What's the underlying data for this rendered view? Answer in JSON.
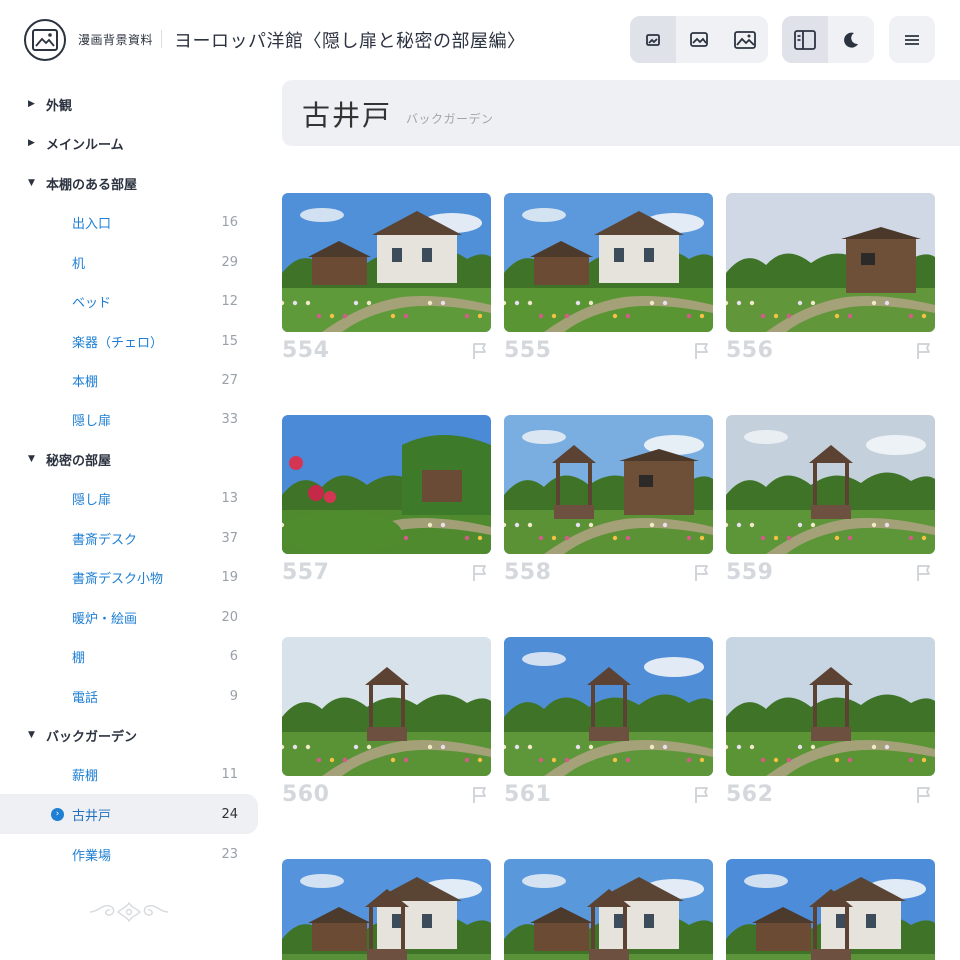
{
  "header": {
    "site_name": "漫画背景資料",
    "page_heading": "ヨーロッパ洋館〈隠し扉と秘密の部屋編〉",
    "size_buttons": [
      "image-small-icon",
      "image-medium-icon",
      "image-large-icon"
    ],
    "view_buttons": [
      "sidebar-toggle-icon",
      "moon-icon"
    ],
    "menu_button": "menu-icon"
  },
  "sidebar": {
    "sections": [
      {
        "label": "外観",
        "expanded": false
      },
      {
        "label": "メインルーム",
        "expanded": false
      },
      {
        "label": "本棚のある部屋",
        "expanded": true,
        "items": [
          {
            "label": "出入口",
            "count": "16"
          },
          {
            "label": "机",
            "count": "29"
          },
          {
            "label": "ベッド",
            "count": "12"
          },
          {
            "label": "楽器（チェロ）",
            "count": "15"
          },
          {
            "label": "本棚",
            "count": "27"
          },
          {
            "label": "隠し扉",
            "count": "33"
          }
        ]
      },
      {
        "label": "秘密の部屋",
        "expanded": true,
        "items": [
          {
            "label": "隠し扉",
            "count": "13"
          },
          {
            "label": "書斎デスク",
            "count": "37"
          },
          {
            "label": "書斎デスク小物",
            "count": "19"
          },
          {
            "label": "暖炉・絵画",
            "count": "20"
          },
          {
            "label": "棚",
            "count": "6"
          },
          {
            "label": "電話",
            "count": "9"
          }
        ]
      },
      {
        "label": "バックガーデン",
        "expanded": true,
        "items": [
          {
            "label": "薪棚",
            "count": "11"
          },
          {
            "label": "古井戸",
            "count": "24",
            "current": true
          },
          {
            "label": "作業場",
            "count": "23"
          }
        ]
      }
    ]
  },
  "main": {
    "title": "古井戸",
    "subtitle": "バックガーデン",
    "photos": [
      {
        "number": "554",
        "scene": "house"
      },
      {
        "number": "555",
        "scene": "house2"
      },
      {
        "number": "556",
        "scene": "shed"
      },
      {
        "number": "557",
        "scene": "roses"
      },
      {
        "number": "558",
        "scene": "shedwell"
      },
      {
        "number": "559",
        "scene": "wellfar"
      },
      {
        "number": "560",
        "scene": "wellside"
      },
      {
        "number": "561",
        "scene": "well"
      },
      {
        "number": "562",
        "scene": "wellclose"
      },
      {
        "number": "",
        "scene": "wellhouse"
      },
      {
        "number": "",
        "scene": "wellhouse2"
      },
      {
        "number": "",
        "scene": "wellhouse3"
      }
    ]
  },
  "colors": {
    "link": "#1e7fd4",
    "nav_text": "#2c3340",
    "panel_bg": "#eef0f3",
    "photo_number": "#d4d7db"
  }
}
